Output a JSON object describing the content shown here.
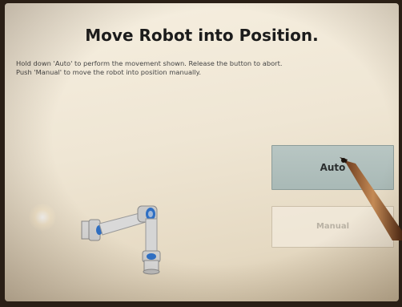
{
  "dialog": {
    "title": "Move Robot into Position.",
    "instructions": [
      "Hold down 'Auto' to perform the movement shown. Release the button to abort.",
      "Push 'Manual' to move the robot into position manually."
    ]
  },
  "buttons": {
    "auto_label": "Auto",
    "manual_label": "Manual"
  },
  "colors": {
    "auto_button": "#b3c2bf",
    "manual_button_disabled": "#f0e9dc",
    "title_text": "#1c1c1c"
  },
  "icons": [
    "robot-arm-illustration"
  ]
}
